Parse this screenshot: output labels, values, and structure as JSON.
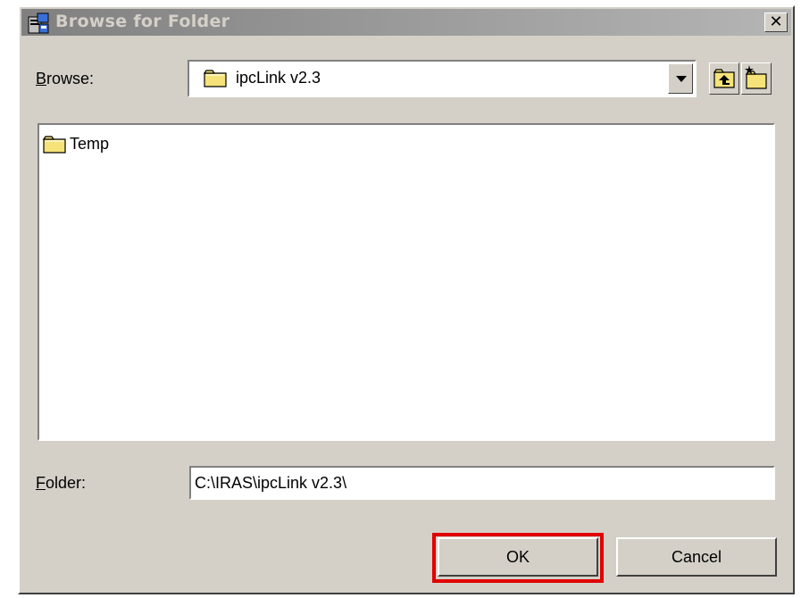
{
  "window": {
    "title": "Browse for Folder",
    "close_glyph": "✕",
    "icon": "browse-folder-app-icon"
  },
  "browse": {
    "label_hotkey": "B",
    "label_rest": "rowse:",
    "selected_value": "ipcLink v2.3",
    "icons": [
      "folder-icon",
      "dropdown-arrow-icon",
      "up-one-level-icon",
      "create-new-folder-icon"
    ]
  },
  "list": {
    "items": [
      {
        "label": "Temp",
        "icon": "folder-icon"
      }
    ]
  },
  "folder": {
    "label_hotkey": "F",
    "label_rest": "older:",
    "value": "C:\\IRAS\\ipcLink v2.3\\"
  },
  "buttons": {
    "ok_label": "OK",
    "cancel_label": "Cancel"
  },
  "colors": {
    "dialog_bg": "#d4d0c8",
    "highlight": "#e00000",
    "folder_yellow": "#f5e37a"
  }
}
